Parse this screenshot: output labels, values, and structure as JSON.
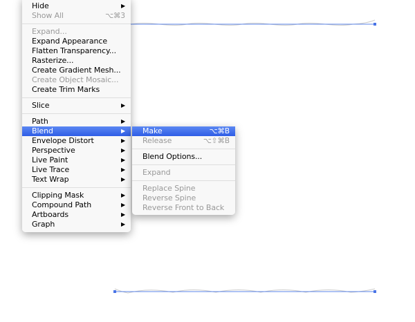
{
  "main_menu": {
    "items": [
      {
        "label": "Hide",
        "submenu": true
      },
      {
        "label": "Show All",
        "shortcut": "⌥⌘3",
        "disabled": true
      },
      {
        "sep": true
      },
      {
        "label": "Expand...",
        "disabled": true
      },
      {
        "label": "Expand Appearance"
      },
      {
        "label": "Flatten Transparency..."
      },
      {
        "label": "Rasterize..."
      },
      {
        "label": "Create Gradient Mesh..."
      },
      {
        "label": "Create Object Mosaic...",
        "disabled": true
      },
      {
        "label": "Create Trim Marks"
      },
      {
        "sep": true
      },
      {
        "label": "Slice",
        "submenu": true
      },
      {
        "sep": true
      },
      {
        "label": "Path",
        "submenu": true
      },
      {
        "label": "Blend",
        "submenu": true,
        "highlighted": true
      },
      {
        "label": "Envelope Distort",
        "submenu": true
      },
      {
        "label": "Perspective",
        "submenu": true
      },
      {
        "label": "Live Paint",
        "submenu": true
      },
      {
        "label": "Live Trace",
        "submenu": true
      },
      {
        "label": "Text Wrap",
        "submenu": true
      },
      {
        "sep": true
      },
      {
        "label": "Clipping Mask",
        "submenu": true
      },
      {
        "label": "Compound Path",
        "submenu": true
      },
      {
        "label": "Artboards",
        "submenu": true
      },
      {
        "label": "Graph",
        "submenu": true
      }
    ]
  },
  "blend_submenu": {
    "items": [
      {
        "label": "Make",
        "shortcut": "⌥⌘B",
        "highlighted": true
      },
      {
        "label": "Release",
        "shortcut": "⌥⇧⌘B",
        "disabled": true
      },
      {
        "sep": true
      },
      {
        "label": "Blend Options..."
      },
      {
        "sep": true
      },
      {
        "label": "Expand",
        "disabled": true
      },
      {
        "sep": true
      },
      {
        "label": "Replace Spine",
        "disabled": true
      },
      {
        "label": "Reverse Spine",
        "disabled": true
      },
      {
        "label": "Reverse Front to Back",
        "disabled": true
      }
    ]
  },
  "colors": {
    "highlight": "#3b67ea",
    "path": "#5b84e8"
  }
}
